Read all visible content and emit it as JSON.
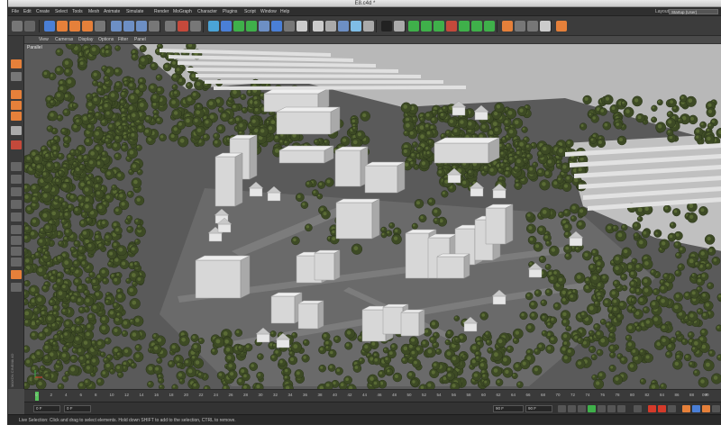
{
  "window": {
    "title": "E8.c4d *"
  },
  "menubar": {
    "items": [
      "File",
      "Edit",
      "Create",
      "Select",
      "Tools",
      "Mesh",
      "Animate",
      "Simulate",
      "Render",
      "MoGraph",
      "Character",
      "Plugins",
      "Script",
      "Window",
      "Help"
    ],
    "layout_label": "Layout:",
    "layout_value": "Startup (User)"
  },
  "viewport": {
    "menu": [
      "View",
      "Cameras",
      "Display",
      "Options",
      "Filter",
      "Panel"
    ],
    "camera_label": "Parallel",
    "background_color": "#5a5a5a",
    "tree_color": "#3d4a25",
    "tree_highlight": "#5a6b35",
    "building_color": "#d7d7d7",
    "ground_color": "#6a6a6a",
    "road_color": "#7c7c7c"
  },
  "timeline": {
    "ticks": [
      "0",
      "2",
      "4",
      "6",
      "8",
      "10",
      "12",
      "14",
      "16",
      "18",
      "20",
      "22",
      "24",
      "26",
      "28",
      "30",
      "32",
      "34",
      "36",
      "38",
      "40",
      "42",
      "44",
      "46",
      "48",
      "50",
      "52",
      "54",
      "56",
      "58",
      "60",
      "62",
      "64",
      "66",
      "68",
      "70",
      "72",
      "74",
      "76",
      "78",
      "80",
      "82",
      "84",
      "86",
      "88",
      "90"
    ],
    "end_frame": "0 F"
  },
  "controls": {
    "start_field": "0 F",
    "current_field": "0 F",
    "end_field": "90 F",
    "max_field": "90 F",
    "accent_colors": {
      "play": "#3fb04a",
      "record": "#d43a2a",
      "key": "#e5803a",
      "highlight": "#4a7fd6"
    }
  },
  "status": {
    "text": "Live Selection: Click and drag to select elements. Hold down SHIFT to add to the selection, CTRL to remove."
  },
  "brand": {
    "text": "MAXON CINEMA 4D"
  }
}
